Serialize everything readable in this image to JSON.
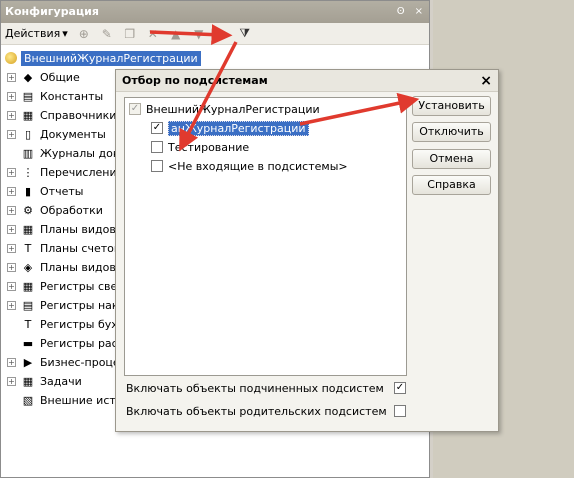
{
  "panel": {
    "title": "Конфигурация",
    "title_buttons": [
      "ʘ",
      "×"
    ],
    "toolbar": {
      "actions_label": "Действия",
      "actions_arrow": "▾",
      "icons": [
        "add-icon",
        "edit-icon",
        "copy-icon",
        "delete-icon",
        "move-up-icon",
        "move-down-icon",
        "dropdown-icon",
        "filter-subsystems-icon"
      ]
    }
  },
  "tree": {
    "root": "ВнешнийЖурналРегистрации",
    "items": [
      {
        "label": "Общие",
        "icon": "◆",
        "expand": "+"
      },
      {
        "label": "Константы",
        "icon": "▤",
        "expand": "+"
      },
      {
        "label": "Справочники",
        "icon": "▦",
        "expand": "+"
      },
      {
        "label": "Документы",
        "icon": "▯",
        "expand": "+"
      },
      {
        "label": "Журналы док",
        "icon": "▥",
        "expand": ""
      },
      {
        "label": "Перечислени",
        "icon": "⋮",
        "expand": "+"
      },
      {
        "label": "Отчеты",
        "icon": "▮",
        "expand": "+"
      },
      {
        "label": "Обработки",
        "icon": "⚙",
        "expand": "+"
      },
      {
        "label": "Планы видов",
        "icon": "▦",
        "expand": "+"
      },
      {
        "label": "Планы счетов",
        "icon": "Т",
        "expand": "+"
      },
      {
        "label": "Планы видов",
        "icon": "◈",
        "expand": "+"
      },
      {
        "label": "Регистры све",
        "icon": "▦",
        "expand": "+"
      },
      {
        "label": "Регистры нак",
        "icon": "▤",
        "expand": "+"
      },
      {
        "label": "Регистры бух",
        "icon": "Т",
        "expand": ""
      },
      {
        "label": "Регистры рас",
        "icon": "▬",
        "expand": ""
      },
      {
        "label": "Бизнес-проце",
        "icon": "▶",
        "expand": "+"
      },
      {
        "label": "Задачи",
        "icon": "▦",
        "expand": "+"
      },
      {
        "label": "Внешние исто",
        "icon": "▧",
        "expand": ""
      }
    ]
  },
  "dialog": {
    "title": "Отбор по подсистемам",
    "close": "×",
    "list": {
      "root": {
        "label": "ВнешнийЖурналРегистрации",
        "checked": "✓"
      },
      "children": [
        {
          "label": "ВнешнийЖурналРегистрации",
          "checked": "✓",
          "selected": true,
          "display": "анЖурналРегистрации"
        },
        {
          "label": "Тестирование",
          "checked": ""
        },
        {
          "label": "<Не входящие в подсистемы>",
          "checked": ""
        }
      ]
    },
    "buttons": {
      "install": "Установить",
      "disable": "Отключить",
      "cancel": "Отмена",
      "help": "Справка"
    },
    "options": [
      {
        "label": "Включать объекты подчиненных подсистем",
        "checked": "✓"
      },
      {
        "label": "Включать объекты родительских подсистем",
        "checked": ""
      }
    ]
  },
  "colors": {
    "accent_selection": "#3b6fc4",
    "arrow_red": "#e03a2e"
  }
}
